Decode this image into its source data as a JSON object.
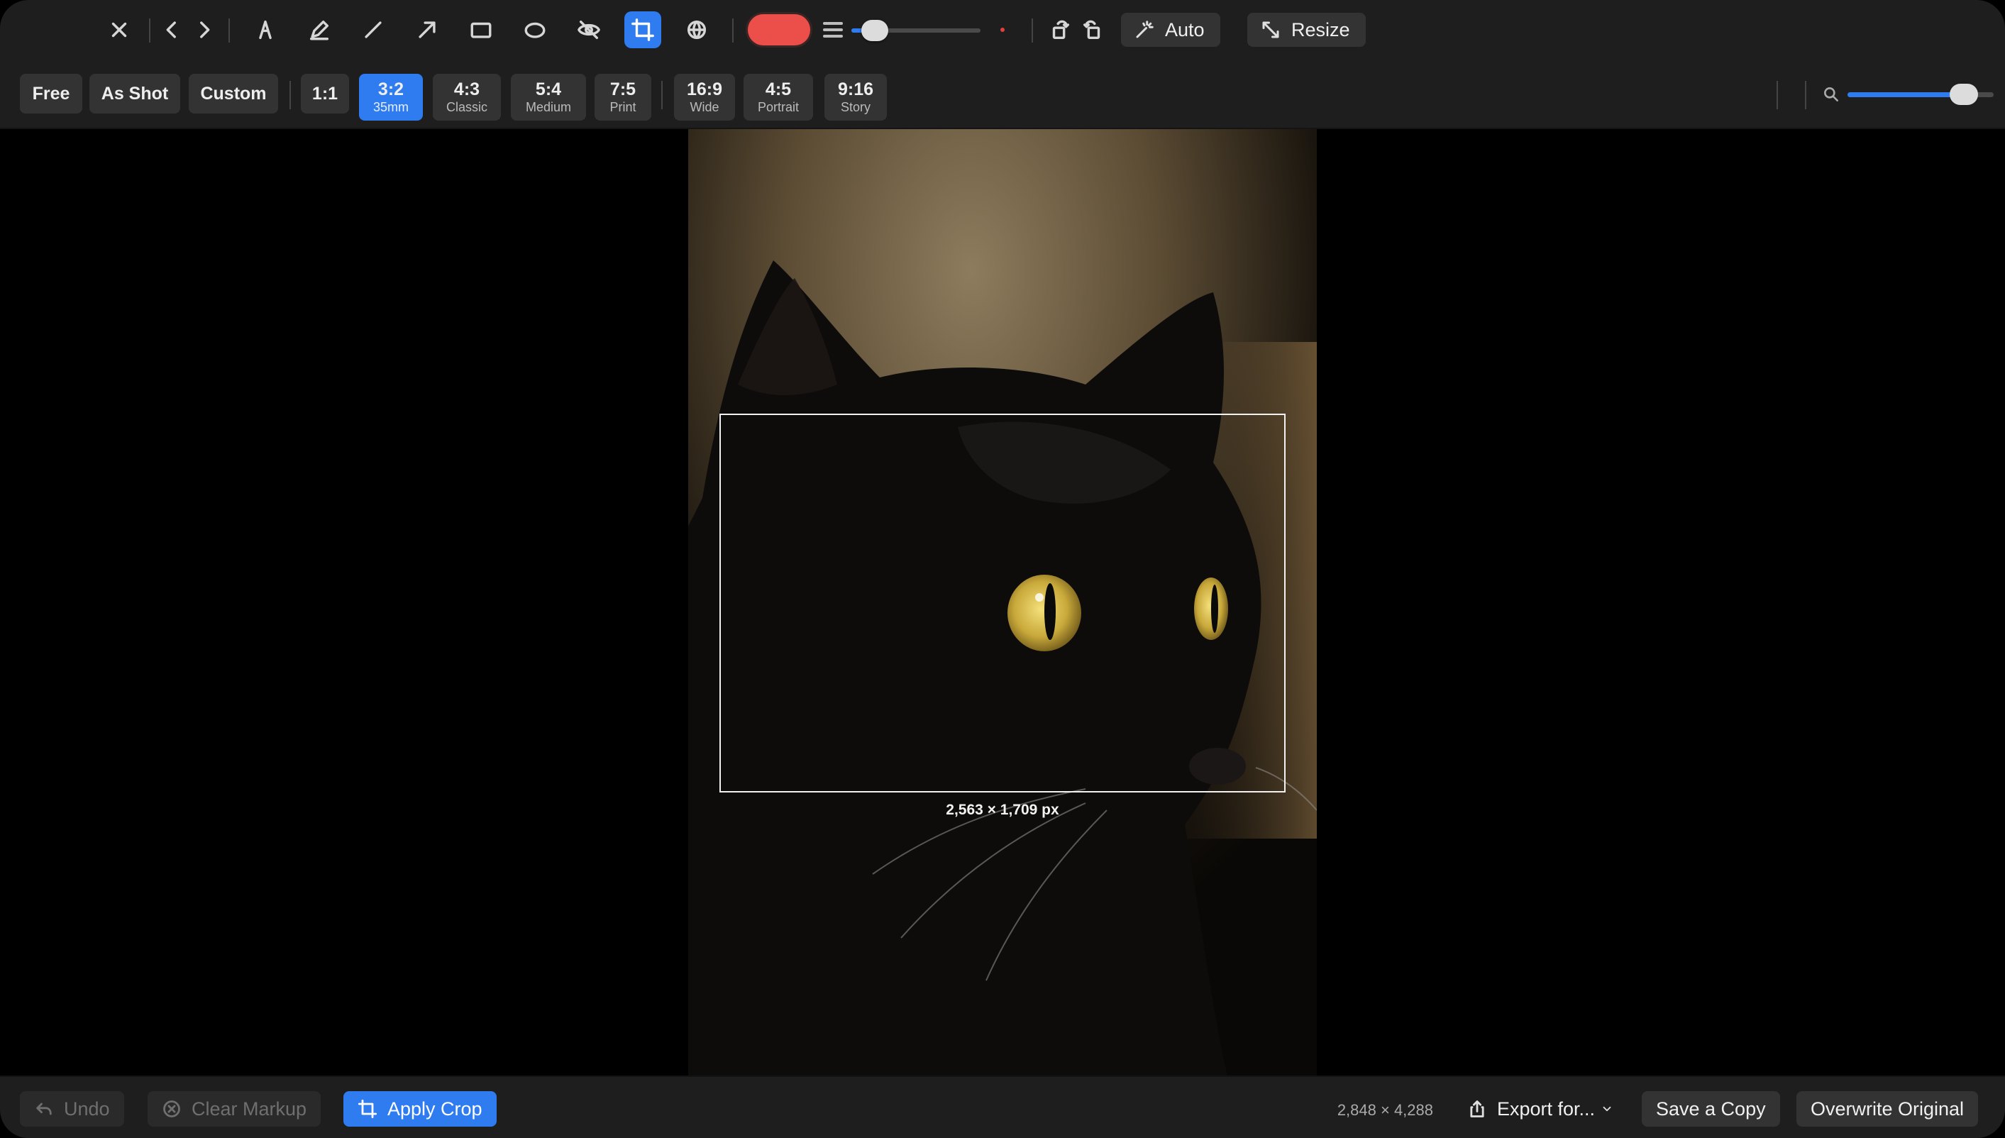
{
  "toolbar": {
    "auto_label": "Auto",
    "resize_label": "Resize",
    "markup_color": "#ec4f4a",
    "stroke_width_fraction": 0.1,
    "accent": "#2f7bf0"
  },
  "aspect": {
    "free": "Free",
    "as_shot": "As Shot",
    "custom": "Custom",
    "square": "1:1",
    "presets": [
      {
        "ratio": "3:2",
        "name": "35mm",
        "active": true
      },
      {
        "ratio": "4:3",
        "name": "Classic"
      },
      {
        "ratio": "5:4",
        "name": "Medium"
      },
      {
        "ratio": "7:5",
        "name": "Print"
      },
      {
        "ratio": "16:9",
        "name": "Wide"
      },
      {
        "ratio": "4:5",
        "name": "Portrait"
      },
      {
        "ratio": "9:16",
        "name": "Story"
      }
    ],
    "zoom_fraction": 0.87
  },
  "canvas": {
    "crop_dims": "2,563 × 1,709 px"
  },
  "bottom": {
    "undo": "Undo",
    "clear_markup": "Clear Markup",
    "apply_crop": "Apply Crop",
    "image_dims": "2,848 × 4,288",
    "export": "Export for...",
    "save_copy": "Save a Copy",
    "overwrite": "Overwrite Original"
  }
}
